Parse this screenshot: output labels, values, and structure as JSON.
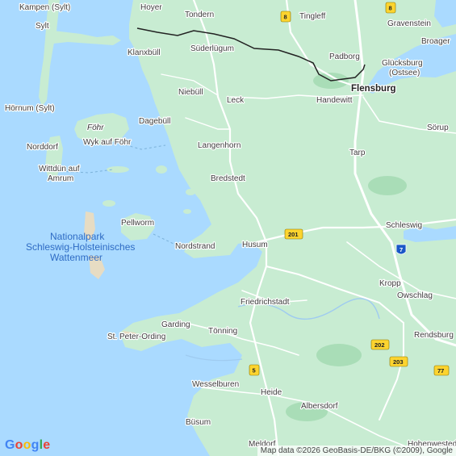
{
  "logo": {
    "letters": [
      {
        "ch": "G",
        "color": "#4285F4"
      },
      {
        "ch": "o",
        "color": "#EA4335"
      },
      {
        "ch": "o",
        "color": "#FBBC05"
      },
      {
        "ch": "g",
        "color": "#4285F4"
      },
      {
        "ch": "l",
        "color": "#34A853"
      },
      {
        "ch": "e",
        "color": "#EA4335"
      }
    ]
  },
  "attribution": "Map data ©2026 GeoBasis-DE/BKG (©2009), Google",
  "colors": {
    "water": "#aadaff",
    "land": "#c8ecd2",
    "mudflat": "#e7dcc3",
    "road": "#ffffff",
    "border": "#222222",
    "shield": "#fcd42f",
    "autobahn_shield": "#1a57c7"
  },
  "places": {
    "kampen": "Kampen (Sylt)",
    "hoyer": "Hoyer",
    "tondern": "Tondern",
    "tingleff": "Tingleff",
    "gravenstein": "Gravenstein",
    "sylt": "Sylt",
    "broager": "Broager",
    "klanxbuell": "Klanxbüll",
    "suederluegum": "Süderlügum",
    "padborg": "Padborg",
    "gluecksburg": "Glücksburg\n(Ostsee)",
    "niebuell": "Niebüll",
    "flensburg": "Flensburg",
    "hoernum": "Hörnum (Sylt)",
    "leck": "Leck",
    "handewitt": "Handewitt",
    "dagebuell": "Dagebüll",
    "foehr": "Föhr",
    "soerup": "Sörup",
    "norddorf": "Norddorf",
    "wyk": "Wyk auf Föhr",
    "langenhorn": "Langenhorn",
    "tarp": "Tarp",
    "wittduen": "Wittdün auf\nAmrum",
    "bredstedt": "Bredstedt",
    "pellworm": "Pellworm",
    "schleswig": "Schleswig",
    "nationalpark": "Nationalpark\nSchleswig-Holsteinisches\nWattenmeer",
    "nordstrand": "Nordstrand",
    "husum": "Husum",
    "kropp": "Kropp",
    "owschlag": "Owschlag",
    "friedrichstadt": "Friedrichstadt",
    "garding": "Garding",
    "tating": "Tönning",
    "st_peter": "St. Peter-Ording",
    "rendsburg": "Rendsburg",
    "wesselburen": "Wesselburen",
    "heide": "Heide",
    "albersdorf": "Albersdorf",
    "buesum": "Büsum",
    "meldorf": "Meldorf",
    "hohenwestedt": "Hohenwestedt"
  },
  "shields": {
    "s8a": "8",
    "s8b": "8",
    "s201": "201",
    "s7": "7",
    "s202": "202",
    "s203": "203",
    "s77": "77",
    "s5": "5"
  }
}
